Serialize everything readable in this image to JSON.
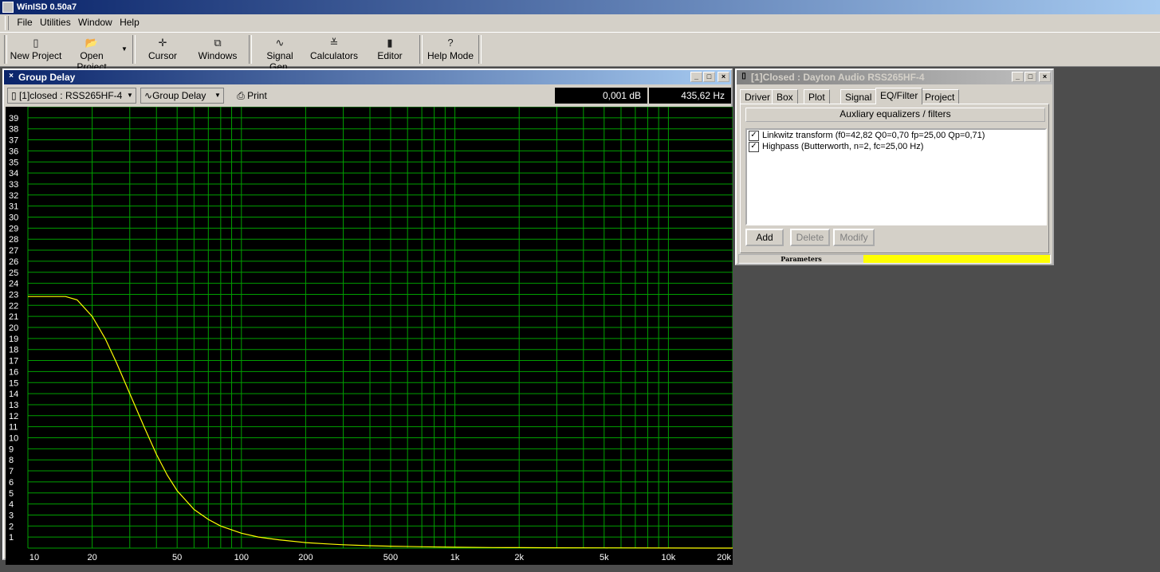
{
  "app": {
    "title": "WinISD 0.50a7"
  },
  "menu": [
    "File",
    "Utilities",
    "Window",
    "Help"
  ],
  "toolbar": {
    "new_project": "New Project",
    "open_project": "Open Project",
    "cursor": "Cursor",
    "windows": "Windows",
    "signal_gen": "Signal Gen.",
    "calculators": "Calculators",
    "editor": "Editor",
    "help_mode": "Help Mode"
  },
  "group_delay_window": {
    "title": "Group Delay",
    "project_select": "[1]closed : RSS265HF-4",
    "plot_select": "Group Delay",
    "print_label": "Print",
    "readout_db": "0,001 dB",
    "readout_hz": "435,62 Hz"
  },
  "project_window": {
    "title": "[1]Closed : Dayton Audio RSS265HF-4",
    "tabs": [
      "Driver",
      "Box",
      "Plot",
      "Signal",
      "EQ/Filter",
      "Project"
    ],
    "active_tab": "EQ/Filter",
    "section_label": "Auxliary equalizers / filters",
    "filters": [
      {
        "label": "Linkwitz transform (f0=42,82 Q0=0,70 fp=25,00 Qp=0,71)",
        "checked": true
      },
      {
        "label": "Highpass (Butterworth, n=2, fc=25,00 Hz)",
        "checked": true
      }
    ],
    "add_label": "Add",
    "delete_label": "Delete",
    "modify_label": "Modify",
    "status_label": "Parameters",
    "status_color": "#ffff00"
  },
  "colors": {
    "plot_bg": "#000000",
    "grid": "#00a000",
    "curve": "#ffff00",
    "title_active": "#0a246a"
  },
  "chart_data": {
    "type": "line",
    "title": "",
    "xlabel": "",
    "ylabel": "",
    "x_scale": "log",
    "xlim": [
      10,
      20000
    ],
    "ylim": [
      0,
      40
    ],
    "grid": true,
    "x_tick_labels": [
      "10",
      "20",
      "50",
      "100",
      "200",
      "500",
      "1k",
      "2k",
      "5k",
      "10k",
      "20k"
    ],
    "x_tick_values": [
      10,
      20,
      50,
      100,
      200,
      500,
      1000,
      2000,
      5000,
      10000,
      20000
    ],
    "y_tick_labels": [
      "1",
      "2",
      "3",
      "4",
      "5",
      "6",
      "7",
      "8",
      "9",
      "10",
      "11",
      "12",
      "13",
      "14",
      "15",
      "16",
      "17",
      "18",
      "19",
      "20",
      "21",
      "22",
      "23",
      "24",
      "25",
      "26",
      "27",
      "28",
      "29",
      "30",
      "31",
      "32",
      "33",
      "34",
      "35",
      "36",
      "37",
      "38",
      "39"
    ],
    "series": [
      {
        "color": "#ffff00",
        "x": [
          10,
          12,
          15,
          17,
          20,
          23,
          26,
          30,
          35,
          40,
          45,
          50,
          60,
          70,
          80,
          100,
          120,
          150,
          200,
          250,
          300,
          400,
          500,
          700,
          1000,
          1500,
          2000,
          3000,
          5000,
          10000,
          20000
        ],
        "y": [
          22.8,
          22.8,
          22.8,
          22.5,
          21.0,
          19.0,
          16.8,
          14.0,
          11.0,
          8.5,
          6.6,
          5.2,
          3.5,
          2.6,
          2.0,
          1.35,
          1.0,
          0.75,
          0.5,
          0.38,
          0.3,
          0.22,
          0.17,
          0.12,
          0.08,
          0.05,
          0.04,
          0.03,
          0.02,
          0.01,
          0.0
        ]
      }
    ]
  }
}
